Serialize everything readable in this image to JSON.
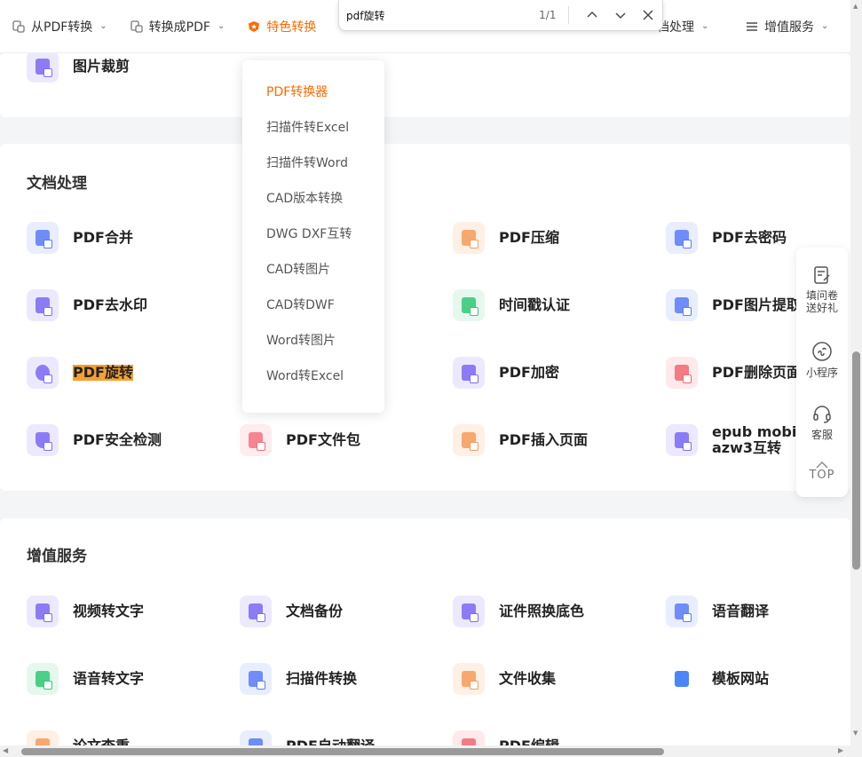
{
  "nav": {
    "items": [
      {
        "label": "从PDF转换",
        "icon": "pdf-convert-icon"
      },
      {
        "label": "转换成PDF",
        "icon": "to-pdf-icon"
      },
      {
        "label": "特色转换",
        "icon": "star-badge-icon"
      },
      {
        "label": "档处理",
        "icon": "doc-process-icon"
      },
      {
        "label": "增值服务",
        "icon": "menu-list-icon"
      }
    ],
    "active_color": "#ff6a00"
  },
  "find": {
    "query": "pdf旋转",
    "count": "1/1"
  },
  "top_card": {
    "tools": [
      {
        "label": "图片裁剪",
        "icon": "image-crop-icon"
      }
    ]
  },
  "doc_section": {
    "title": "文档处理",
    "tools": [
      {
        "label": "PDF合并",
        "icon": "pdf-merge-icon"
      },
      {
        "label": "PDF压缩",
        "icon": "pdf-compress-icon"
      },
      {
        "label": "PDF去密码",
        "icon": "pdf-unlock-icon"
      },
      {
        "label": "PDF去水印",
        "icon": "pdf-remove-watermark-icon"
      },
      {
        "label": "时间戳认证",
        "icon": "timestamp-icon"
      },
      {
        "label": "PDF图片提取",
        "icon": "pdf-image-extract-icon"
      },
      {
        "label": "PDF旋转",
        "icon": "pdf-rotate-icon"
      },
      {
        "label": "PDF加密",
        "icon": "pdf-encrypt-icon"
      },
      {
        "label": "PDF删除页面",
        "icon": "pdf-delete-page-icon"
      },
      {
        "label": "PDF安全检测",
        "icon": "pdf-security-check-icon"
      },
      {
        "label": "PDF文件包",
        "icon": "pdf-package-icon"
      },
      {
        "label": "PDF插入页面",
        "icon": "pdf-insert-page-icon"
      },
      {
        "label": "epub mobi azw3互转",
        "icon": "ebook-convert-icon"
      }
    ]
  },
  "value_section": {
    "title": "增值服务",
    "tools": [
      {
        "label": "视频转文字",
        "icon": "video-to-text-icon"
      },
      {
        "label": "文档备份",
        "icon": "doc-backup-icon"
      },
      {
        "label": "证件照换底色",
        "icon": "id-photo-icon"
      },
      {
        "label": "语音翻译",
        "icon": "voice-translate-icon"
      },
      {
        "label": "语音转文字",
        "icon": "voice-to-text-icon"
      },
      {
        "label": "扫描件转换",
        "icon": "scan-convert-icon"
      },
      {
        "label": "文件收集",
        "icon": "file-collect-icon"
      },
      {
        "label": "模板网站",
        "icon": "cloud-icon"
      },
      {
        "label": "论文查重",
        "icon": "paper-check-icon"
      },
      {
        "label": "PDF自动翻译",
        "icon": "pdf-translate-icon"
      },
      {
        "label": "PDF编辑",
        "icon": "pdf-edit-icon"
      }
    ]
  },
  "dropdown": {
    "items": [
      "PDF转换器",
      "扫描件转Excel",
      "扫描件转Word",
      "CAD版本转换",
      "DWG DXF互转",
      "CAD转图片",
      "CAD转DWF",
      "Word转图片",
      "Word转Excel"
    ]
  },
  "side_panel": {
    "survey": [
      "填问卷",
      "送好礼"
    ],
    "miniprogram": "小程序",
    "service": "客服",
    "top": "TOP"
  }
}
